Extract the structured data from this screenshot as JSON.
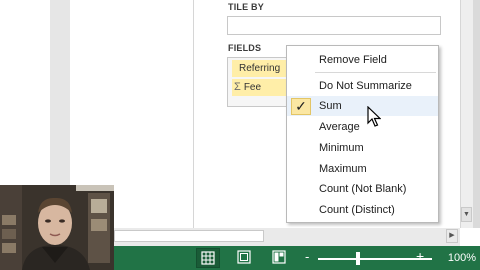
{
  "panel": {
    "tile_by_label": "TILE BY",
    "fields_label": "FIELDS",
    "fields": [
      {
        "label": "Referring"
      },
      {
        "label": "Fee",
        "icon": "sigma-icon"
      }
    ]
  },
  "context_menu": {
    "items": [
      {
        "label": "Remove Field",
        "checked": false
      },
      {
        "label": "Do Not Summarize",
        "checked": false
      },
      {
        "label": "Sum",
        "checked": true
      },
      {
        "label": "Average",
        "checked": false
      },
      {
        "label": "Minimum",
        "checked": false
      },
      {
        "label": "Maximum",
        "checked": false
      },
      {
        "label": "Count (Not Blank)",
        "checked": false
      },
      {
        "label": "Count (Distinct)",
        "checked": false
      }
    ],
    "check_glyph": "✓"
  },
  "status_bar": {
    "zoom_level": "100%",
    "zoom_minus": "-",
    "zoom_plus": "+",
    "zoom_fraction": 0.35,
    "color": "#217346"
  },
  "colors": {
    "field_highlight": "#ffeea8",
    "accent": "#217346"
  }
}
